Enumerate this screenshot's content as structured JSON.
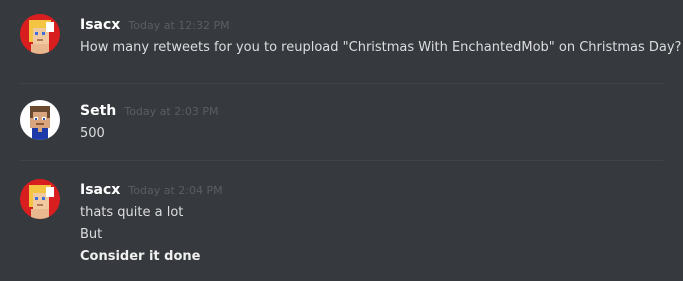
{
  "messages": [
    {
      "username": "Isacx",
      "timestamp": "Today at 12:32 PM",
      "avatar": "isacx-avatar",
      "lines": [
        "How many retweets for you to reupload \"Christmas With EnchantedMob\" on Christmas Day?"
      ]
    },
    {
      "username": "Seth",
      "timestamp": "Today at 2:03 PM",
      "avatar": "seth-avatar",
      "lines": [
        "500"
      ]
    },
    {
      "username": "Isacx",
      "timestamp": "Today at 2:04 PM",
      "avatar": "isacx-avatar",
      "lines": [
        "thats quite a lot",
        "But",
        "Consider it done"
      ]
    }
  ],
  "colors": {
    "background": "#36393e",
    "username": "#ffffff",
    "timestamp": "#5a5d63",
    "message_text": "#dcddde",
    "divider": "#40434a",
    "avatar_isacx_bg": "#d81e1e",
    "avatar_seth_bg": "#ffffff"
  }
}
